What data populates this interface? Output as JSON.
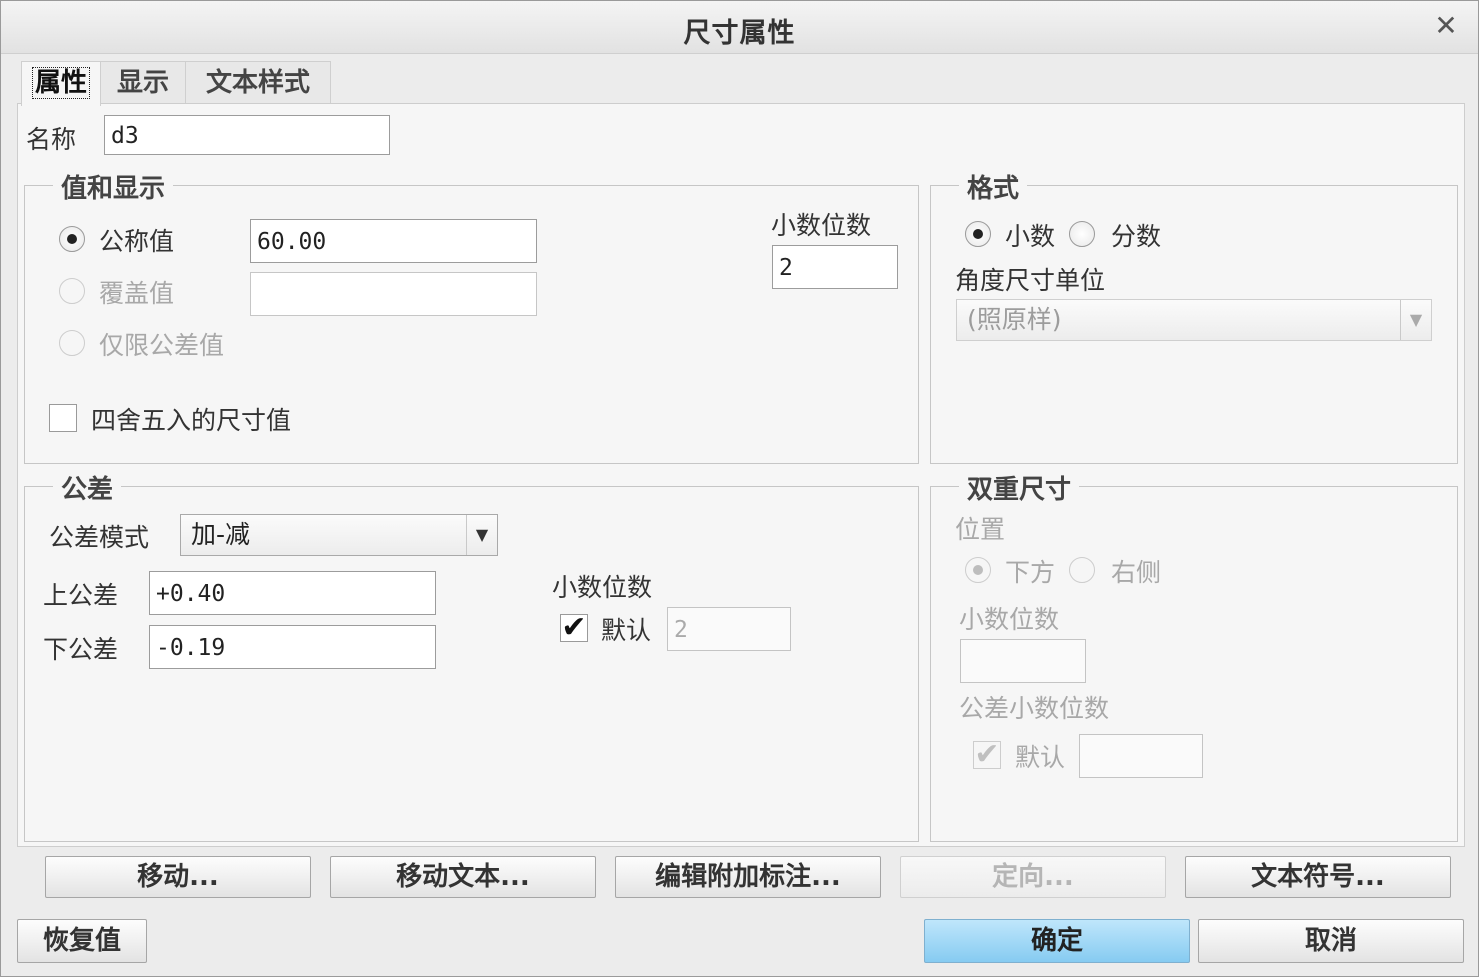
{
  "title": "尺寸属性",
  "tabs": [
    "属性",
    "显示",
    "文本样式"
  ],
  "name": {
    "label": "名称",
    "value": "d3"
  },
  "value_display": {
    "legend": "值和显示",
    "nominal_label": "公称值",
    "nominal_value": "60.00",
    "override_label": "覆盖值",
    "override_value": "",
    "tolerance_only_label": "仅限公差值",
    "round_label": "四舍五入的尺寸值",
    "decimals_label": "小数位数",
    "decimals_value": "2"
  },
  "format": {
    "legend": "格式",
    "decimal_label": "小数",
    "fraction_label": "分数",
    "angle_unit_label": "角度尺寸单位",
    "angle_unit_value": "(照原样)"
  },
  "tolerance": {
    "legend": "公差",
    "mode_label": "公差模式",
    "mode_value": "加-减",
    "upper_label": "上公差",
    "upper_value": "+0.40",
    "lower_label": "下公差",
    "lower_value": "-0.19",
    "decimals_label": "小数位数",
    "default_label": "默认",
    "default_value": "2"
  },
  "dual": {
    "legend": "双重尺寸",
    "position_label": "位置",
    "below_label": "下方",
    "right_label": "右侧",
    "decimals_label": "小数位数",
    "decimals_value": "",
    "tol_decimals_label": "公差小数位数",
    "default_label": "默认",
    "default_value": ""
  },
  "buttons": {
    "move": "移动...",
    "move_text": "移动文本...",
    "edit_annotation": "编辑附加标注...",
    "orient": "定向...",
    "text_symbol": "文本符号...",
    "restore": "恢复值",
    "ok": "确定",
    "cancel": "取消"
  },
  "icons": {
    "close": "close-icon",
    "checkmark": "checkmark-icon",
    "dropdown": "chevron-down-icon"
  }
}
